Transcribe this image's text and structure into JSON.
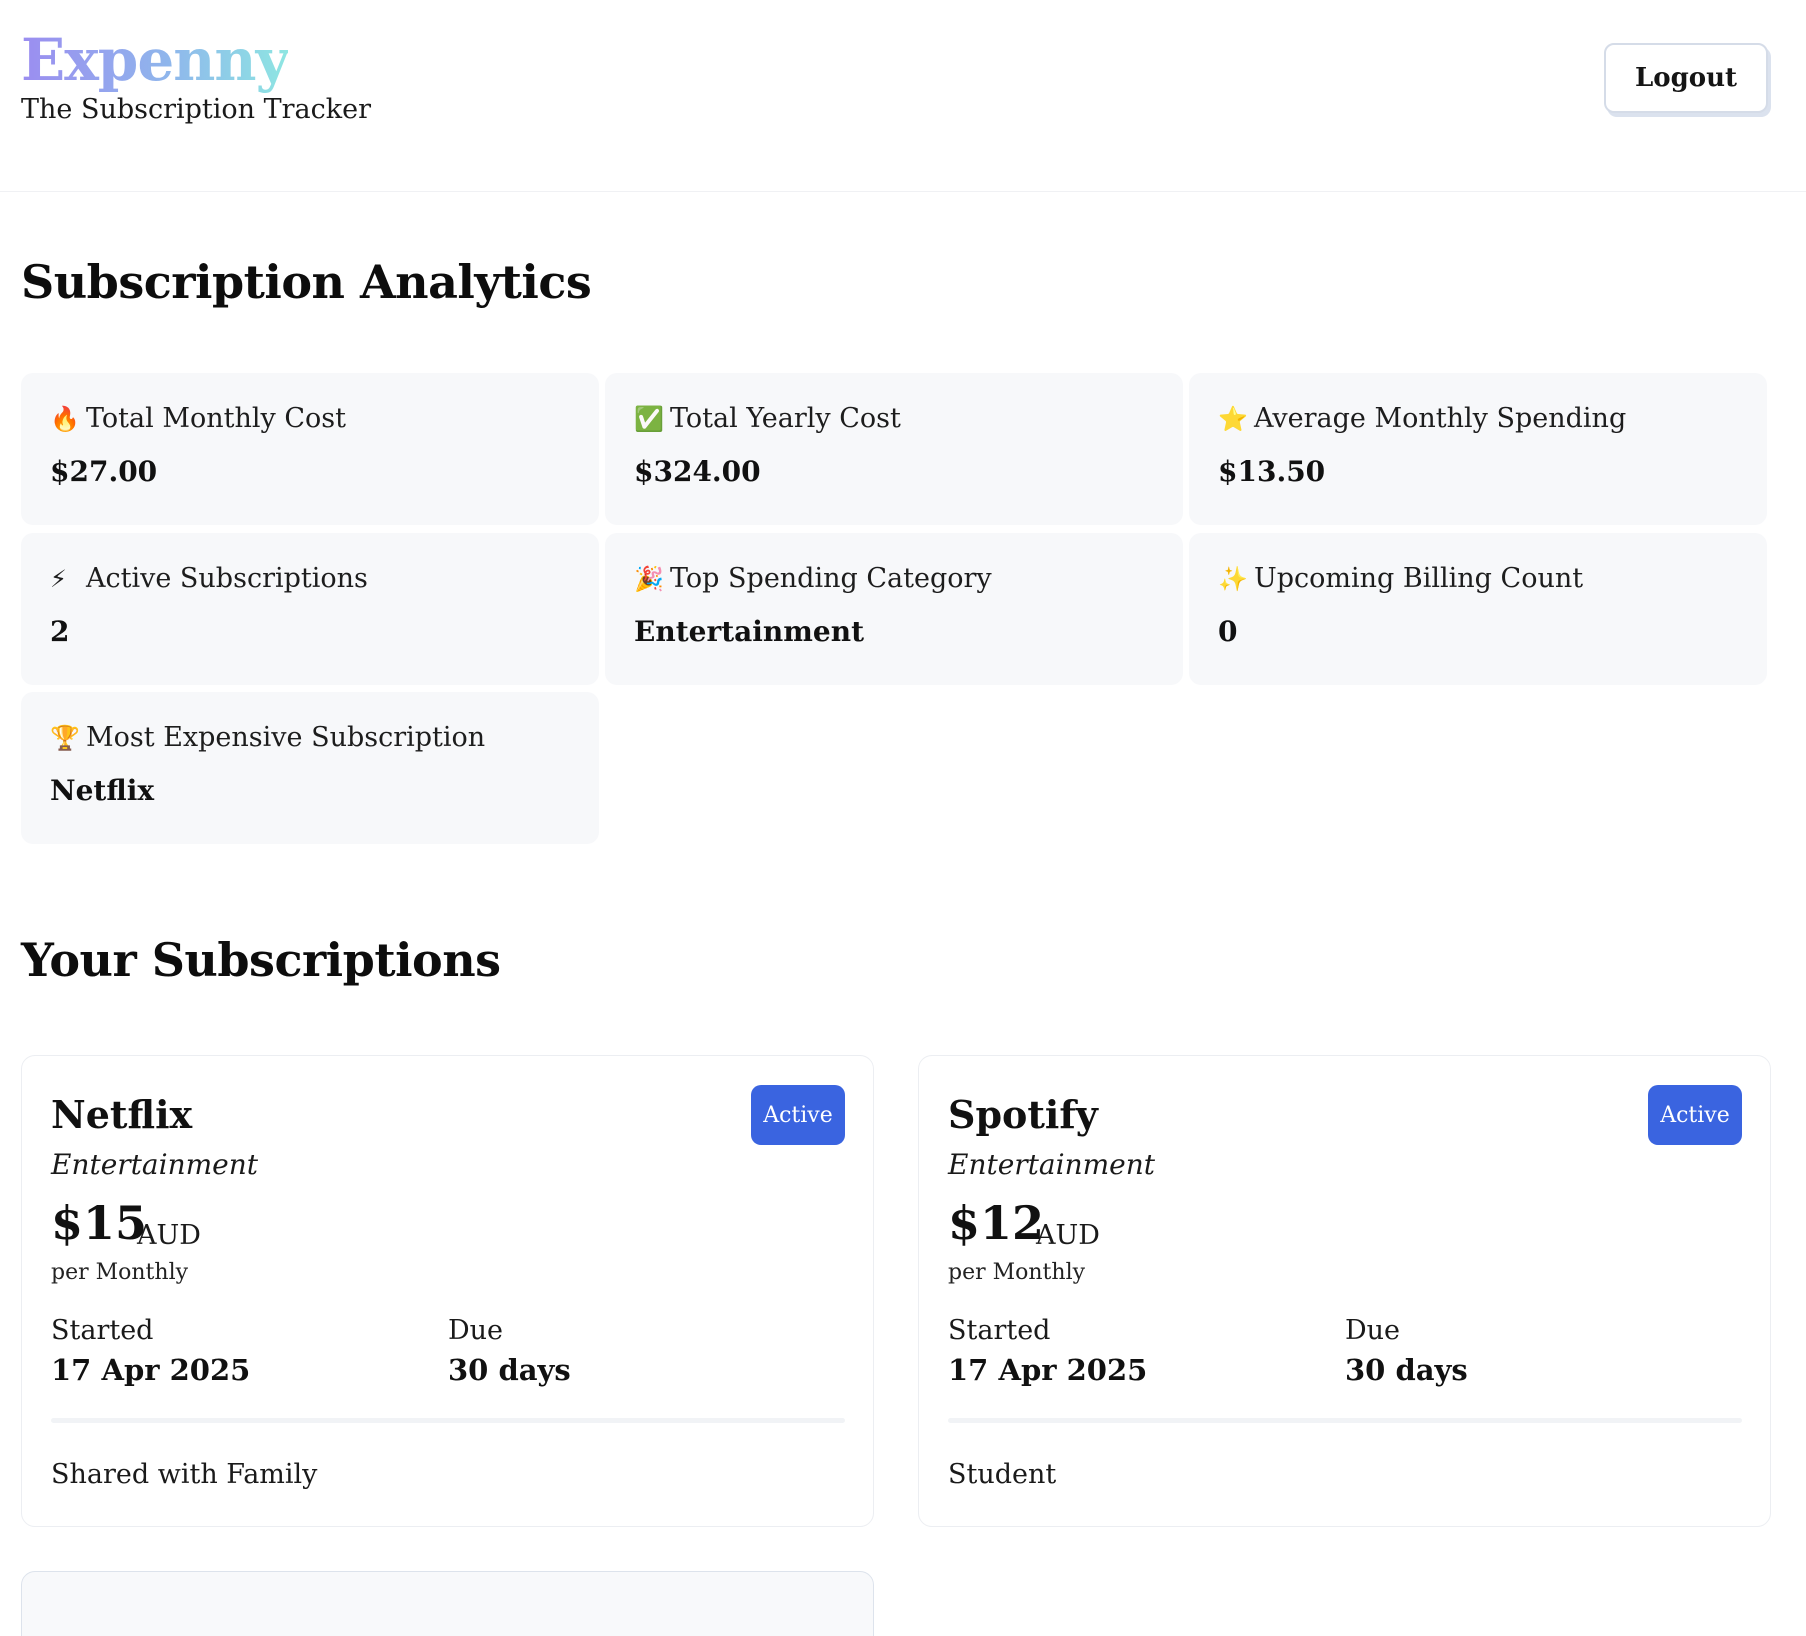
{
  "header": {
    "app_name": "Expenny",
    "tagline": "The Subscription Tracker",
    "logout_label": "Logout"
  },
  "analytics": {
    "title": "Subscription Analytics",
    "stats": [
      {
        "icon": "fire-icon",
        "icon_glyph": "🔥",
        "label": "Total Monthly Cost",
        "value": "$27.00"
      },
      {
        "icon": "check-mark-icon",
        "icon_glyph": "✅",
        "label": "Total Yearly Cost",
        "value": "$324.00"
      },
      {
        "icon": "star-icon",
        "icon_glyph": "⭐",
        "label": "Average Monthly Spending",
        "value": "$13.50"
      },
      {
        "icon": "lightning-icon",
        "icon_glyph": "⚡",
        "label": "Active Subscriptions",
        "value": "2"
      },
      {
        "icon": "party-popper-icon",
        "icon_glyph": "🎉",
        "label": "Top Spending Category",
        "value": "Entertainment"
      },
      {
        "icon": "sparkles-icon",
        "icon_glyph": "✨",
        "label": "Upcoming Billing Count",
        "value": "0"
      },
      {
        "icon": "trophy-icon",
        "icon_glyph": "🏆",
        "label": "Most Expensive Subscription",
        "value": "Netflix"
      }
    ]
  },
  "subscriptions": {
    "title": "Your Subscriptions",
    "items": [
      {
        "name": "Netflix",
        "status": "Active",
        "category": "Entertainment",
        "price": "$15",
        "currency": "AUD",
        "period": "per Monthly",
        "started_label": "Started",
        "started_value": "17 Apr 2025",
        "due_label": "Due",
        "due_value": "30 days",
        "note": "Shared with Family"
      },
      {
        "name": "Spotify",
        "status": "Active",
        "category": "Entertainment",
        "price": "$12",
        "currency": "AUD",
        "period": "per Monthly",
        "started_label": "Started",
        "started_value": "17 Apr 2025",
        "due_label": "Due",
        "due_value": "30 days",
        "note": "Student"
      }
    ]
  },
  "colors": {
    "badge_active": "#3a64e0",
    "stat_background": "#f7f8fa",
    "logo_gradient_start": "#9b8df0",
    "logo_gradient_end": "#8ee6e2"
  }
}
